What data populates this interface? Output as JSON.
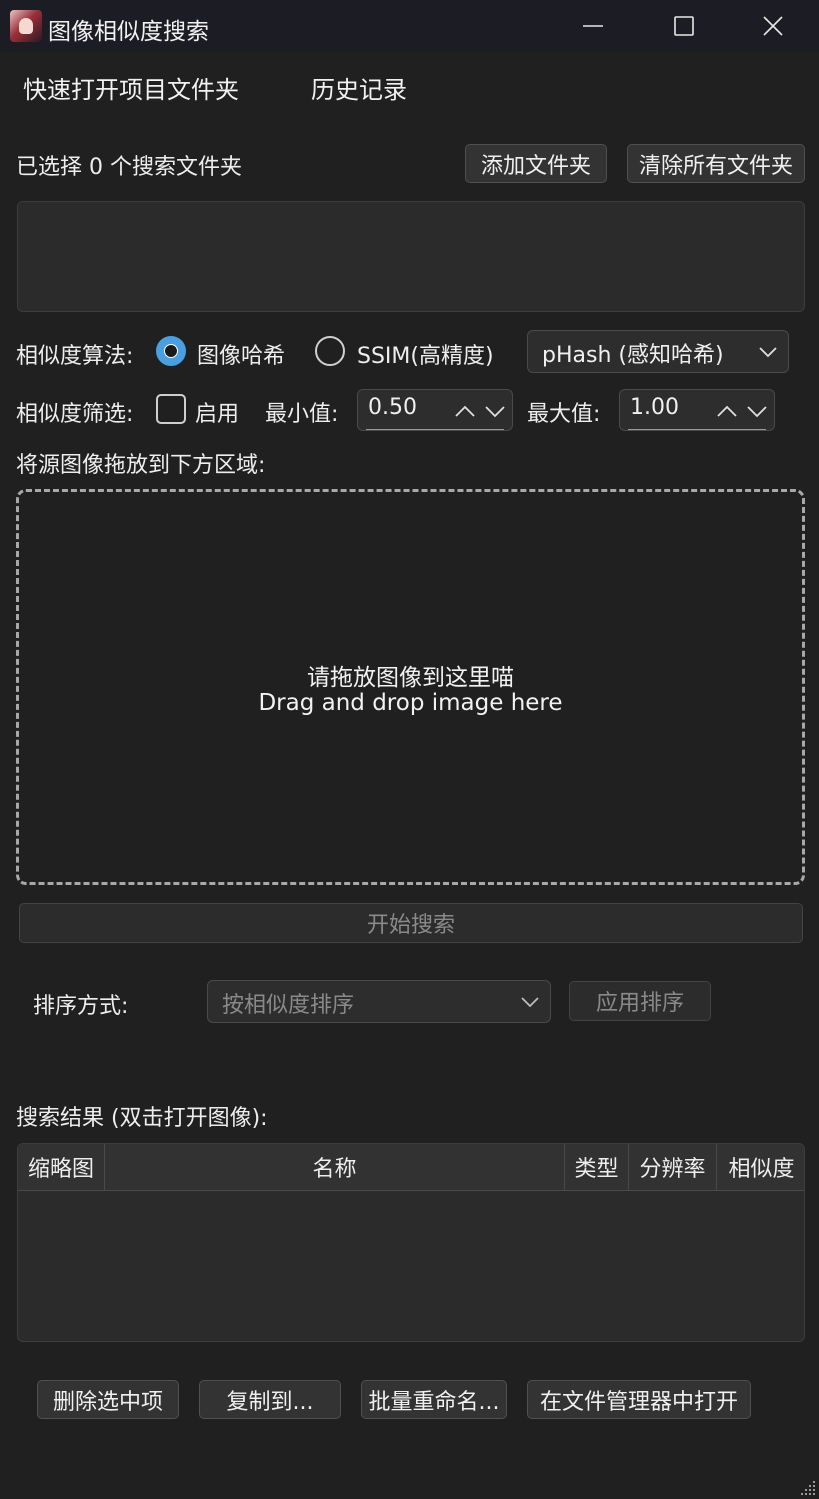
{
  "window": {
    "title": "图像相似度搜索",
    "controls": [
      "minimize-icon",
      "maximize-icon",
      "close-icon"
    ]
  },
  "menu": {
    "quick_open": "快速打开项目文件夹",
    "history": "历史记录"
  },
  "folders": {
    "selected_text": "已选择 0 个搜索文件夹",
    "add_button": "添加文件夹",
    "clear_button": "清除所有文件夹"
  },
  "algorithm": {
    "label": "相似度算法:",
    "option_hash": "图像哈希",
    "option_ssim": "SSIM(高精度)",
    "selected": "图像哈希",
    "hash_method": "pHash (感知哈希)"
  },
  "filter": {
    "label": "相似度筛选:",
    "enable_label": "启用",
    "enabled": false,
    "min_label": "最小值:",
    "min_value": "0.50",
    "max_label": "最大值:",
    "max_value": "1.00"
  },
  "drop": {
    "label": "将源图像拖放到下方区域:",
    "hint_cn": "请拖放图像到这里喵",
    "hint_en": "Drag and drop image here"
  },
  "search_button": "开始搜索",
  "sort": {
    "label": "排序方式:",
    "value": "按相似度排序",
    "apply_button": "应用排序"
  },
  "results": {
    "label": "搜索结果 (双击打开图像):",
    "columns": [
      "缩略图",
      "名称",
      "类型",
      "分辨率",
      "相似度"
    ],
    "rows": []
  },
  "actions": {
    "delete": "删除选中项",
    "copy_to": "复制到...",
    "batch_rename": "批量重命名...",
    "open_in_explorer": "在文件管理器中打开"
  },
  "colors": {
    "background": "#202020",
    "titlebar": "#1c1c24",
    "accent": "#4a9fe0"
  }
}
